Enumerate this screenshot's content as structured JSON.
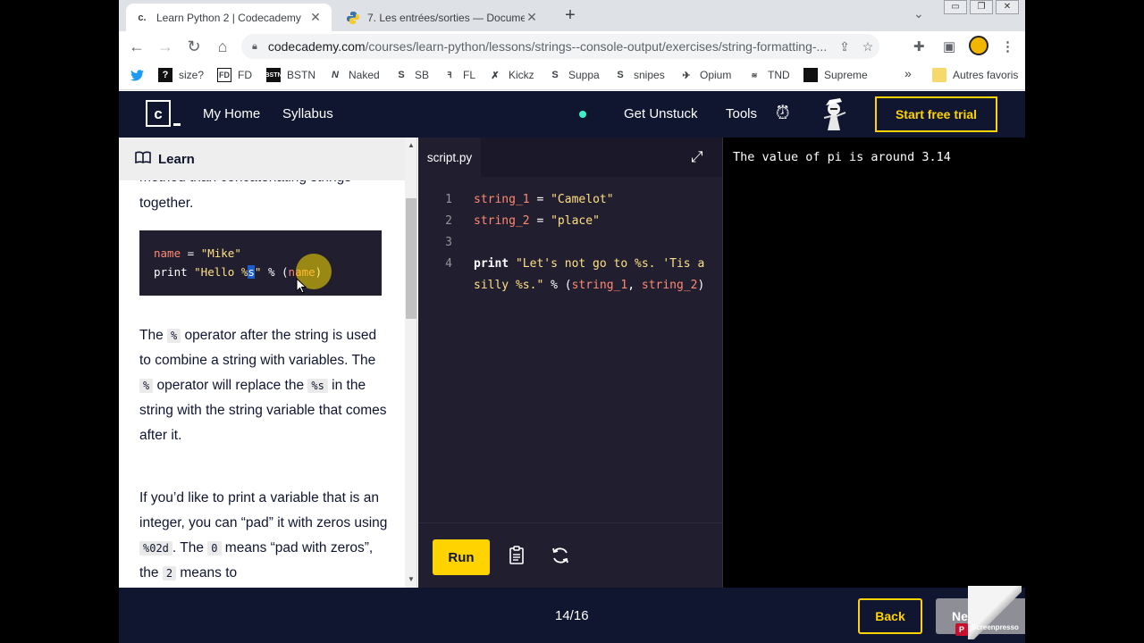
{
  "browser": {
    "tabs": [
      {
        "icon": "c.",
        "title": "Learn Python 2 | Codecademy"
      },
      {
        "icon": "py",
        "title": "7. Les entrées/sorties — Docume"
      }
    ],
    "new_tab": "+",
    "tab_close": "✕",
    "address": {
      "host": "codecademy.com",
      "path": "/courses/learn-python/lessons/strings--console-output/exercises/string-formatting-..."
    },
    "bookmarks": [
      {
        "icon": "twitter",
        "label": ""
      },
      {
        "icon": "?",
        "label": "size?"
      },
      {
        "icon": "FD",
        "label": "FD"
      },
      {
        "icon": "BSTN",
        "label": "BSTN"
      },
      {
        "icon": "N",
        "label": "Naked"
      },
      {
        "icon": "S",
        "label": "SB"
      },
      {
        "icon": "FL",
        "label": "FL"
      },
      {
        "icon": "K",
        "label": "Kickz"
      },
      {
        "icon": "S",
        "label": "Suppa"
      },
      {
        "icon": "S",
        "label": "snipes"
      },
      {
        "icon": "O",
        "label": "Opium"
      },
      {
        "icon": "TND",
        "label": "TND"
      },
      {
        "icon": "■",
        "label": "Supreme"
      }
    ],
    "bookmarks_more": "»",
    "other_bookmarks": "Autres favoris"
  },
  "header": {
    "logo_letter": "c",
    "nav": [
      "My Home",
      "Syllabus"
    ],
    "get_unstuck": "Get Unstuck",
    "tools": "Tools",
    "trial_button": "Start free trial"
  },
  "learn": {
    "title": "Learn",
    "cut_text": "method than concatenating strings",
    "together": "together.",
    "snippet": {
      "line1": {
        "name": "name",
        "eq": " = ",
        "value": "\"Mike\""
      },
      "line2": {
        "kw": "print ",
        "str_a": "\"Hello %",
        "sel": "s",
        "str_b": "\"",
        "op": " % (",
        "var": "name",
        "close": ")"
      }
    },
    "para1": [
      {
        "t": "The "
      },
      {
        "c": "%"
      },
      {
        "t": " operator after the string is used to combine a string with variables. The "
      },
      {
        "c": "%"
      },
      {
        "t": " operator will replace the "
      },
      {
        "c": "%s"
      },
      {
        "t": " in the string with the string variable that comes after it."
      }
    ],
    "para2": [
      {
        "t": "If you’d like to print a variable that is an integer, you can “pad” it with zeros using "
      },
      {
        "c": "%02d"
      },
      {
        "t": ". The "
      },
      {
        "c": "0"
      },
      {
        "t": " means “pad with zeros”, the "
      },
      {
        "c": "2"
      },
      {
        "t": " means to"
      }
    ]
  },
  "editor": {
    "tab": "script.py",
    "lines": [
      {
        "n": "1",
        "parts": [
          {
            "c": "v",
            "t": "string_1"
          },
          {
            "c": "",
            "t": " = "
          },
          {
            "c": "str",
            "t": "\"Camelot\""
          }
        ]
      },
      {
        "n": "2",
        "parts": [
          {
            "c": "v",
            "t": "string_2"
          },
          {
            "c": "",
            "t": " = "
          },
          {
            "c": "str",
            "t": "\"place\""
          }
        ]
      },
      {
        "n": "3",
        "parts": []
      },
      {
        "n": "4",
        "parts": [
          {
            "c": "k",
            "t": "print"
          },
          {
            "c": "",
            "t": " "
          },
          {
            "c": "str",
            "t": "\"Let's not go to %s. 'Tis a"
          }
        ]
      },
      {
        "n": "",
        "parts": [
          {
            "c": "str",
            "t": "silly %s.\""
          },
          {
            "c": "",
            "t": " % ("
          },
          {
            "c": "v",
            "t": "string_1"
          },
          {
            "c": "",
            "t": ", "
          },
          {
            "c": "v",
            "t": "string_2"
          },
          {
            "c": "",
            "t": ")"
          }
        ]
      }
    ],
    "run_label": "Run"
  },
  "output": {
    "line": "The value of pi is around 3.14"
  },
  "footer": {
    "progress": "14/16",
    "back": "Back",
    "next": "Next",
    "watermark": "Screenpresso"
  },
  "colors": {
    "navy": "#10162f",
    "yellow": "#ffd300",
    "editor_bg": "#211e2f"
  }
}
